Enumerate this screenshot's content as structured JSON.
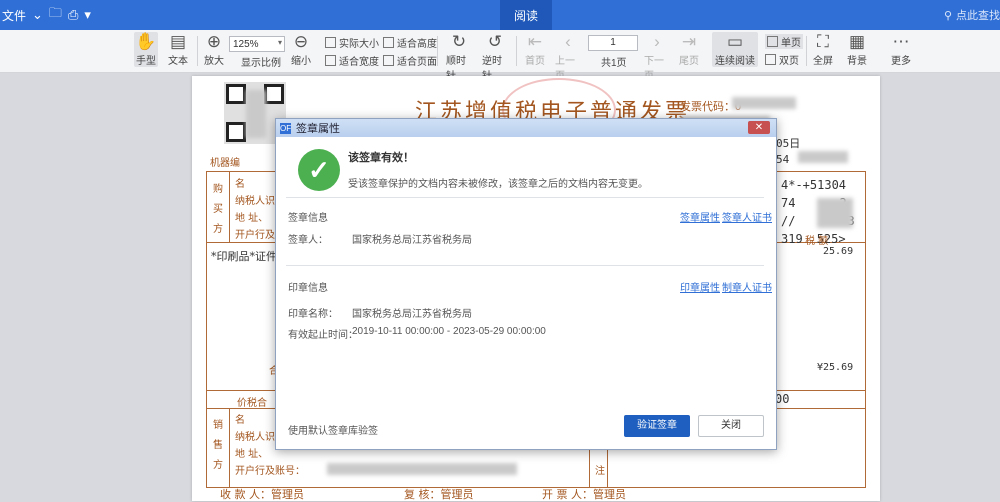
{
  "titlebar": {
    "file_menu": "文件",
    "active_tab": "阅读",
    "search_text": "点此查找"
  },
  "toolbar": {
    "hand": "手型",
    "text": "文本",
    "zoom_in": "放大",
    "zoom_value": "125%",
    "scale": "显示比例",
    "zoom_out": "缩小",
    "actual_size": "实际大小",
    "fit_height": "适合高度",
    "fit_width": "适合宽度",
    "fit_page": "适合页面",
    "rotate_cw": "顺时针",
    "rotate_ccw": "逆时针",
    "first_page": "首页",
    "prev_page": "上一页",
    "page_value": "1",
    "total_pages": "共1页",
    "next_page": "下一页",
    "last_page": "尾页",
    "continuous": "连续阅读",
    "single": "单页",
    "double": "双页",
    "fullscreen": "全屏",
    "background": "背景",
    "more": "更多"
  },
  "invoice": {
    "title": "江苏增值税电子普通发票",
    "code_label": "发票代码：",
    "code_partial": "0",
    "machine_label": "机器编",
    "date_partial": "05日",
    "code_line2": "54",
    "buyer": [
      "购",
      "买",
      "方"
    ],
    "name_label": "名",
    "taxpayer_label": "纳税人识",
    "address_label": "地  址、",
    "bank_label": "开户行及",
    "item_name": "*印刷品*证件",
    "tax_header": "税  额",
    "tax_amount": "25.69",
    "cipher1": "4*-+51304",
    "cipher2": "74",
    "cipher3": "2",
    "cipher4": "//",
    "cipher5": "3",
    "cipher6": "319",
    "cipher7": "525>",
    "total_label": "合",
    "total_tax": "¥25.69",
    "price_tax_label": "价税合",
    "price_tax_partial": "00",
    "seller": [
      "销",
      "售",
      "方"
    ],
    "seller_bank_label": "开户行及账号：",
    "note_label": "注",
    "payee": "收 款 人：管理员",
    "reviewer": "复  核：管理员",
    "drawer": "开 票 人：管理员"
  },
  "dialog": {
    "title": "签章属性",
    "valid_title": "该签章有效！",
    "valid_desc": "受该签章保护的文档内容未被修改，该签章之后的文档内容无变更。",
    "sig_section": "签章信息",
    "sig_props_link": "签章属性",
    "sig_cert_link": "签章人证书",
    "signer_label": "签章人：",
    "signer_value": "国家税务总局江苏省税务局",
    "seal_section": "印章信息",
    "seal_props_link": "印章属性",
    "seal_cert_link": "制章人证书",
    "seal_name_label": "印章名称：",
    "seal_name_value": "国家税务总局江苏省税务局",
    "validity_label": "有效起止时间：",
    "validity_value": "2019-10-11 00:00:00 - 2023-05-29 00:00:00",
    "default_lib": "使用默认签章库验签",
    "verify_button": "验证签章",
    "close_button": "关闭"
  }
}
